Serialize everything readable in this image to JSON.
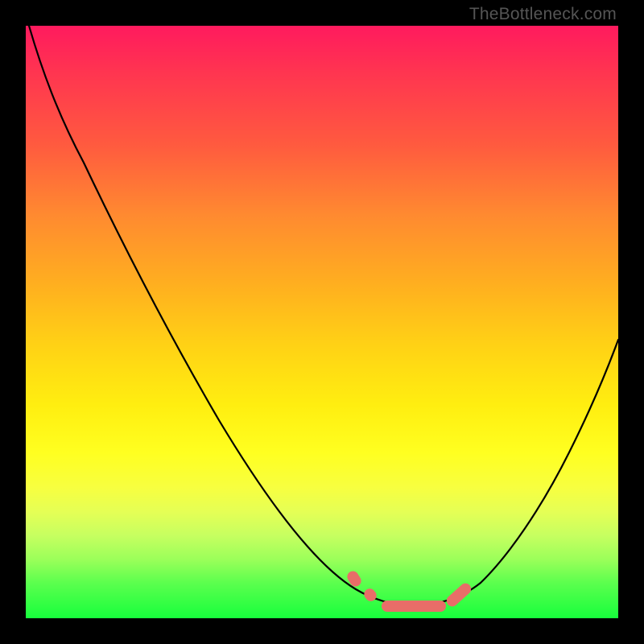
{
  "watermark": "TheBottleneck.com",
  "colors": {
    "background": "#000000",
    "gradient_top": "#ff1a5e",
    "gradient_bottom": "#17ff3c",
    "curve": "#000000",
    "markers": "#e86d68"
  },
  "chart_data": {
    "type": "line",
    "title": "",
    "xlabel": "",
    "ylabel": "",
    "xlim": [
      0,
      100
    ],
    "ylim": [
      0,
      100
    ],
    "grid": false,
    "legend": false,
    "series": [
      {
        "name": "bottleneck-curve",
        "x": [
          0,
          5,
          10,
          15,
          20,
          25,
          30,
          35,
          40,
          45,
          50,
          55,
          58,
          60,
          62,
          65,
          68,
          72,
          76,
          80,
          84,
          88,
          92,
          96,
          100
        ],
        "values": [
          100,
          94,
          86,
          78,
          70,
          62,
          54,
          45,
          36,
          27,
          18,
          10,
          6,
          3,
          1,
          0,
          0,
          1,
          3,
          7,
          13,
          20,
          28,
          37,
          47
        ]
      }
    ],
    "markers_near_minimum_x": [
      55,
      58,
      62,
      66,
      70,
      74
    ]
  }
}
